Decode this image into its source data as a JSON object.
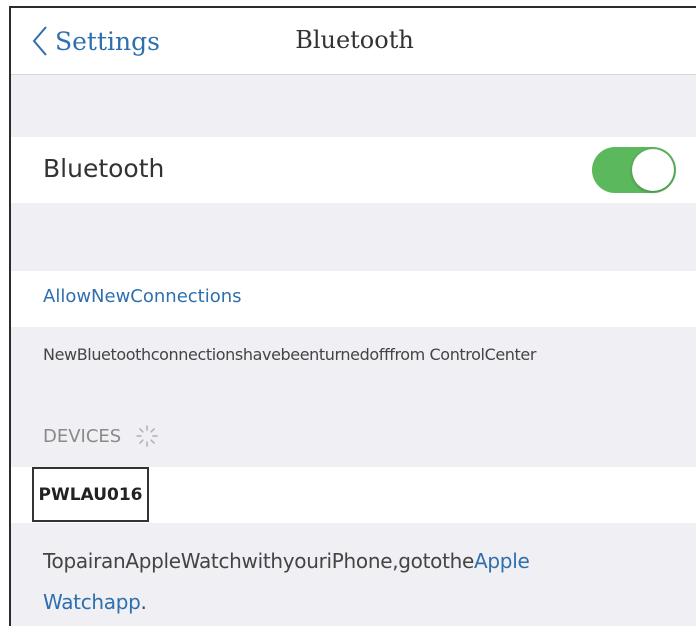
{
  "navbar": {
    "back_label": "Settings",
    "title": "Bluetooth"
  },
  "bluetooth": {
    "label": "Bluetooth",
    "enabled": true,
    "toggle_color": "#5cb85c"
  },
  "allow_new_connections": {
    "label": "AllowNewConnections"
  },
  "note": "NewBluetoothconnectionshavebeenturnedofffrom ControlCenter",
  "devices": {
    "header": "DEVICES",
    "items": [
      "PWLAU016"
    ]
  },
  "footer": {
    "text": "TopairanAppleWatchwithyouriPhone,gotothe",
    "link_part1": "Apple",
    "link_part2": "Watchapp",
    "end": "."
  },
  "colors": {
    "accent": "#2e6fae",
    "background": "#efeff4"
  },
  "icons": [
    "chevron-left-icon",
    "spinner-icon"
  ]
}
